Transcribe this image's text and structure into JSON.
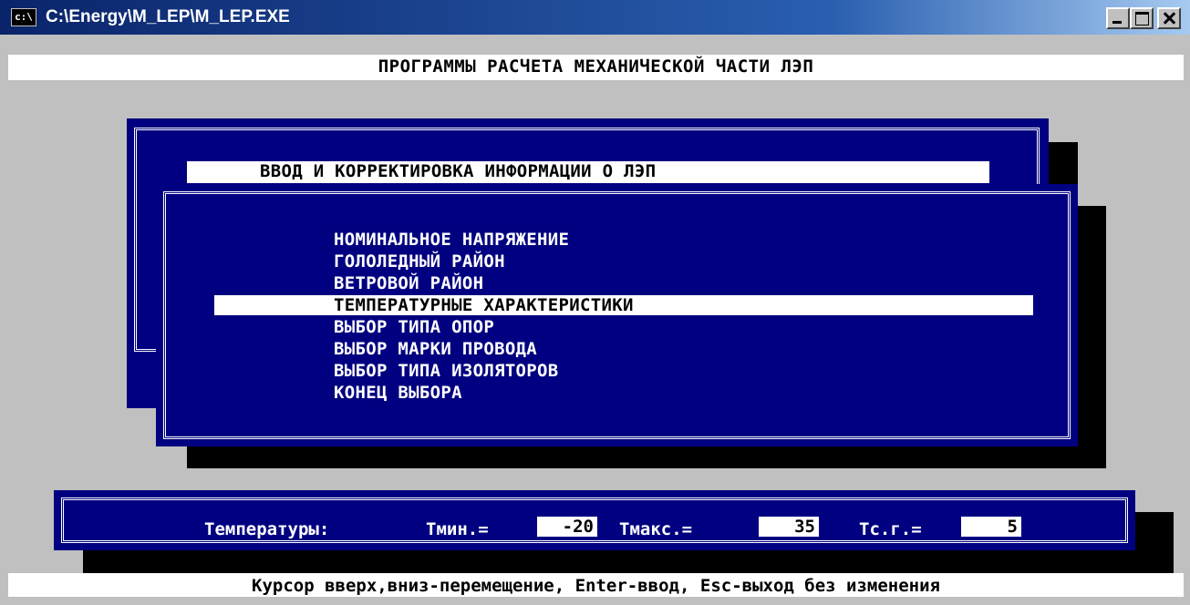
{
  "window": {
    "title": "C:\\Energy\\M_LEP\\M_LEP.EXE",
    "icon_label": "c:\\"
  },
  "header": {
    "title": "ПРОГРАММЫ РАСЧЕТА МЕХАНИЧЕСКОЙ ЧАСТИ ЛЭП"
  },
  "panel": {
    "title": "ВВОД И КОРРЕКТИРОВКА ИНФОРМАЦИИ О ЛЭП"
  },
  "menu": {
    "items": [
      {
        "label": "НОМИНАЛЬНОЕ НАПРЯЖЕНИЕ"
      },
      {
        "label": "ГОЛОЛЕДНЫЙ РАЙОН"
      },
      {
        "label": "ВЕТРОВОЙ РАЙОН"
      },
      {
        "label": "ТЕМПЕРАТУРНЫЕ ХАРАКТЕРИСТИКИ"
      },
      {
        "label": "ВЫБОР ТИПА ОПОР"
      },
      {
        "label": "ВЫБОР МАРКИ ПРОВОДА"
      },
      {
        "label": "ВЫБОР ТИПА ИЗОЛЯТОРОВ"
      },
      {
        "label": "КОНЕЦ ВЫБОРА"
      }
    ],
    "selected_index": 3
  },
  "temperatures": {
    "label": "Температуры:",
    "tmin_label": "Tмин.=",
    "tmin_value": "-20",
    "tmax_label": "Tмакс.=",
    "tmax_value": "35",
    "tsg_label": "Tс.г.=",
    "tsg_value": "5"
  },
  "status": {
    "text": "Курсор вверх,вниз-перемещение, Enter-ввод, Esc-выход без изменения"
  },
  "colors": {
    "console_bg": "#c0c0c0",
    "panel_bg": "#000080",
    "highlight": "#ffffff"
  }
}
